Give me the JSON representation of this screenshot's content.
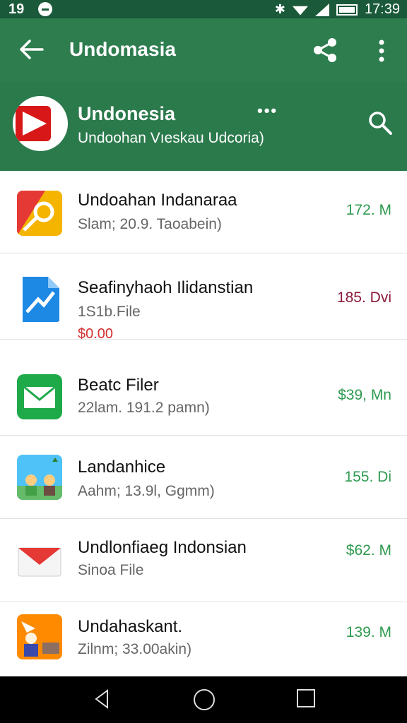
{
  "status": {
    "left_time": "19",
    "right_time": "17:39"
  },
  "appbar": {
    "title": "Undomasia"
  },
  "header": {
    "title": "Undonesia",
    "subtitle": "Undoohan Vıeskau Udcoria)",
    "dots": "•••"
  },
  "items": [
    {
      "name": "Undoahan Indanaraa",
      "meta": "Slam; 20.9. Taoabein)",
      "price": "",
      "size": "172. M",
      "size_color": "#2e9a4f"
    },
    {
      "name": "Seafinyhaoh Ilidanstian",
      "meta": "1S1b.File",
      "price": "$0.00",
      "size": "185. Dvi",
      "size_color": "#8b1a3a"
    },
    {
      "name": "Beatc Filer",
      "meta": "22lam. 191.2 pamn)",
      "price": "",
      "size": "$39, Mn",
      "size_color": "#2e9a4f"
    },
    {
      "name": "Landanhice",
      "meta": "Aahm; 13.9l, Ggmm)",
      "price": "",
      "size": "155. Di",
      "size_color": "#2e9a4f"
    },
    {
      "name": "Undlonfiaeg Indonsian",
      "meta": "Sinoa File",
      "price": "",
      "size": "$62. M",
      "size_color": "#2e9a4f"
    },
    {
      "name": "Undahaskant.",
      "meta": "Zilnm; 33.00akin)",
      "price": "",
      "size": "139. M",
      "size_color": "#2e9a4f"
    }
  ],
  "icons": {
    "item_icons": [
      "photo-editor-icon",
      "chart-file-icon",
      "mail-icon",
      "illustration-icon",
      "envelope-icon",
      "story-icon"
    ]
  }
}
